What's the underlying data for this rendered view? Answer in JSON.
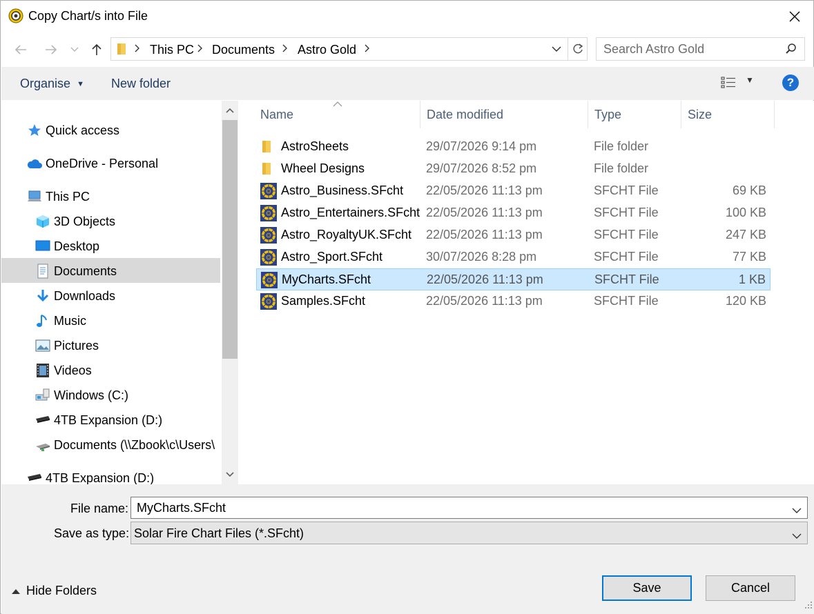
{
  "window": {
    "title": "Copy Chart/s into File"
  },
  "nav": {
    "breadcrumbs": [
      "This PC",
      "Documents",
      "Astro Gold"
    ],
    "search_placeholder": "Search Astro Gold"
  },
  "toolbar": {
    "organise_label": "Organise",
    "new_folder_label": "New folder"
  },
  "sidebar": {
    "items": [
      {
        "label": "Quick access",
        "icon": "star-icon"
      },
      {
        "label": "OneDrive - Personal",
        "icon": "cloud-icon"
      },
      {
        "label": "This PC",
        "icon": "computer-icon"
      },
      {
        "label": "3D Objects",
        "icon": "cube-icon"
      },
      {
        "label": "Desktop",
        "icon": "desktop-icon"
      },
      {
        "label": "Documents",
        "icon": "document-icon",
        "selected": true
      },
      {
        "label": "Downloads",
        "icon": "download-arrow-icon"
      },
      {
        "label": "Music",
        "icon": "music-note-icon"
      },
      {
        "label": "Pictures",
        "icon": "picture-icon"
      },
      {
        "label": "Videos",
        "icon": "film-icon"
      },
      {
        "label": "Windows (C:)",
        "icon": "drive-icon"
      },
      {
        "label": "4TB Expansion (D:)",
        "icon": "external-drive-icon"
      },
      {
        "label": "Documents (\\\\Zbook\\c\\Users\\",
        "icon": "network-drive-icon"
      },
      {
        "label": "4TB Expansion (D:)",
        "icon": "external-drive-icon"
      }
    ]
  },
  "columns": {
    "name": "Name",
    "date": "Date modified",
    "type": "Type",
    "size": "Size"
  },
  "files": [
    {
      "name": "AstroSheets",
      "date": "29/07/2026 9:14 pm",
      "type": "File folder",
      "size": "",
      "icon": "folder-icon"
    },
    {
      "name": "Wheel Designs",
      "date": "29/07/2026 8:52 pm",
      "type": "File folder",
      "size": "",
      "icon": "folder-icon"
    },
    {
      "name": "Astro_Business.SFcht",
      "date": "22/05/2026 11:13 pm",
      "type": "SFCHT File",
      "size": "69 KB",
      "icon": "sfcht-file-icon"
    },
    {
      "name": "Astro_Entertainers.SFcht",
      "date": "22/05/2026 11:13 pm",
      "type": "SFCHT File",
      "size": "100 KB",
      "icon": "sfcht-file-icon"
    },
    {
      "name": "Astro_RoyaltyUK.SFcht",
      "date": "22/05/2026 11:13 pm",
      "type": "SFCHT File",
      "size": "247 KB",
      "icon": "sfcht-file-icon"
    },
    {
      "name": "Astro_Sport.SFcht",
      "date": "30/07/2026 8:28 pm",
      "type": "SFCHT File",
      "size": "77 KB",
      "icon": "sfcht-file-icon"
    },
    {
      "name": "MyCharts.SFcht",
      "date": "22/05/2026 11:13 pm",
      "type": "SFCHT File",
      "size": "1 KB",
      "icon": "sfcht-file-icon",
      "selected": true
    },
    {
      "name": "Samples.SFcht",
      "date": "22/05/2026 11:13 pm",
      "type": "SFCHT File",
      "size": "120 KB",
      "icon": "sfcht-file-icon"
    }
  ],
  "bottom": {
    "file_name_label": "File name:",
    "file_name_value": "MyCharts.SFcht",
    "save_type_label": "Save as type:",
    "save_type_value": "Solar Fire Chart Files (*.SFcht)",
    "hide_folders_label": "Hide Folders",
    "save_label": "Save",
    "cancel_label": "Cancel"
  },
  "colors": {
    "selection": "#cce8ff",
    "selection_border": "#99d1ff",
    "accent": "#0078d7",
    "header_text": "#4c607a"
  }
}
